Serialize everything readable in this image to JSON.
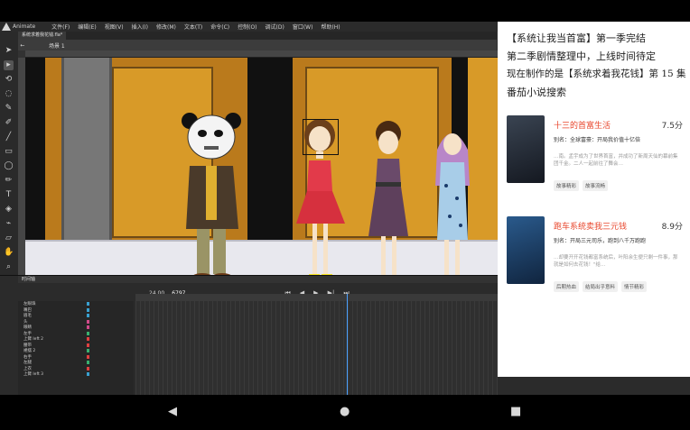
{
  "app": {
    "name": "Animate",
    "menu": [
      "文件(F)",
      "编辑(E)",
      "视图(V)",
      "插入(I)",
      "修改(M)",
      "文本(T)",
      "命令(C)",
      "控制(O)",
      "调试(D)",
      "窗口(W)",
      "帮助(H)"
    ],
    "tab_label": "系统求着我花钱.fla*",
    "scene": "场景 1"
  },
  "timeline": {
    "panel_title": "时间轴",
    "fps": "24.00",
    "frame": "6797",
    "layers": [
      "左眼珠",
      "嘴巴",
      "眉毛",
      "头",
      "眼睛",
      "左手",
      "上臂 left 2",
      "腰带",
      "裙摆 2",
      "右手",
      "左腿",
      "上衣",
      "上臂 left 3"
    ]
  },
  "overlay": {
    "line1": "【系统让我当首富】第一季完结",
    "line2": "第二季剧情整理中，上线时间待定",
    "line3": "现在制作的是【系统求着我花钱】第 15 集",
    "line4": "番茄小说搜索",
    "books": [
      {
        "title": "十三的首富生活",
        "score": "7.5分",
        "alias": "别名：全球富豪：开局我价值十亿倍",
        "desc": "…南。孟宇成为了世界首富，并成功了新周天仙的幕前集团千金。二人一起前往了舞会…",
        "tags": [
          "故事精彩",
          "故事流畅"
        ],
        "cover_color": "#2a2f3a"
      },
      {
        "title": "跑车系统卖我三元钱",
        "score": "8.9分",
        "alias": "别名：开局三元司乐，跑到八千万跑跑",
        "desc": "…却要开开花钱都富系统后，叶阳余生便只剩一件事，那就是如何去花钱！\"给…",
        "tags": [
          "后期热血",
          "结局出乎意料",
          "情节精彩"
        ],
        "cover_color": "#1d3f6b"
      }
    ]
  },
  "navbar": {
    "back": "◀",
    "home": "●",
    "recent": "■"
  },
  "colors": {
    "accent": "#e8452b",
    "stage_wall": "#ba7a1c"
  }
}
